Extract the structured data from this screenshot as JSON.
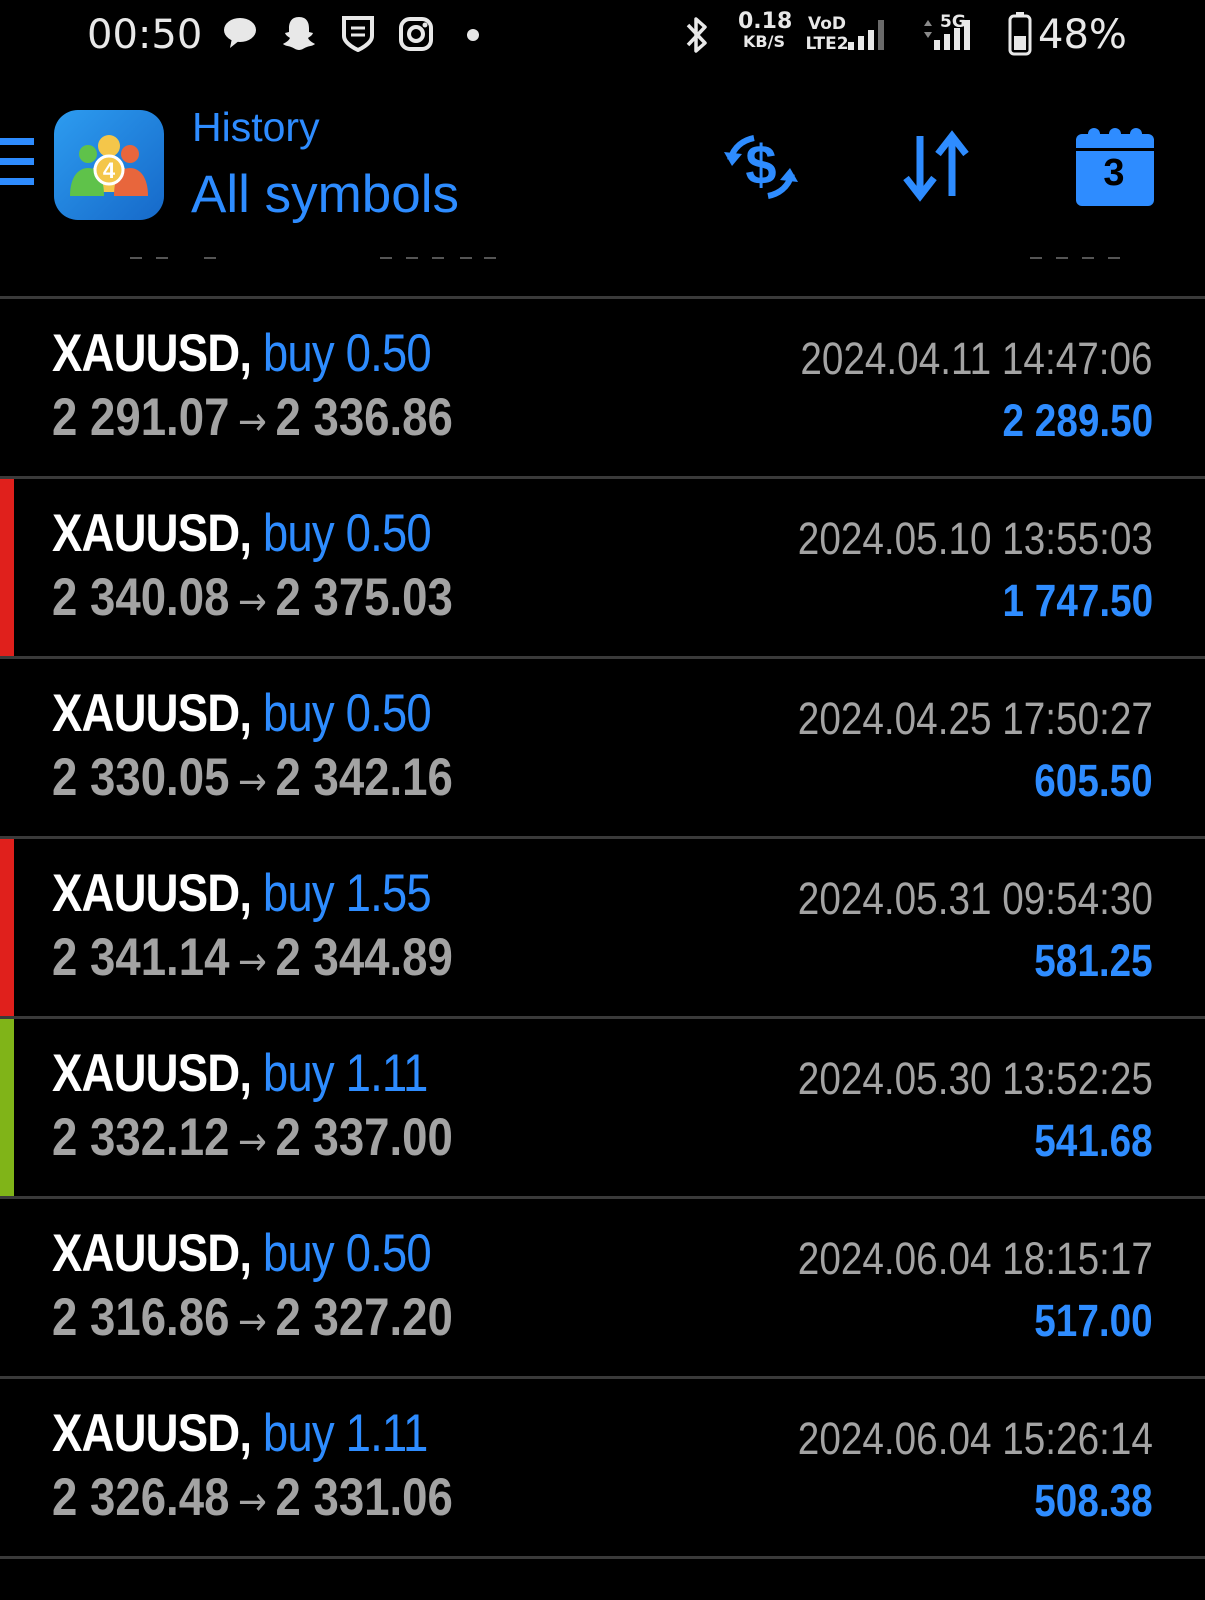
{
  "status_bar": {
    "time": "00:50",
    "net_speed_value": "0.18",
    "net_speed_unit": "KB/S",
    "volte_top": "VoD",
    "volte_bottom": "LTE2",
    "net_type": "5G",
    "battery_percent": "48%",
    "icons": [
      "chat-icon",
      "snapchat-icon",
      "shield-app-icon",
      "instagram-icon",
      "dot-icon",
      "bluetooth-icon",
      "signal-icon",
      "signal-5g-icon",
      "battery-icon"
    ]
  },
  "app_bar": {
    "title": "History",
    "subtitle": "All symbols",
    "logo_badge": "4",
    "calendar_day": "3",
    "accent_color": "#2e8cff",
    "icons": [
      "menu-icon",
      "app-logo-icon",
      "currency-exchange-icon",
      "sort-icon",
      "calendar-icon"
    ]
  },
  "trades": [
    {
      "symbol": "XAUUSD",
      "type": "buy 0.50",
      "open": "2 291.07",
      "close": "2 336.86",
      "time": "2024.04.11 14:47:06",
      "profit": "2 289.50",
      "marker": "none"
    },
    {
      "symbol": "XAUUSD",
      "type": "buy 0.50",
      "open": "2 340.08",
      "close": "2 375.03",
      "time": "2024.05.10 13:55:03",
      "profit": "1 747.50",
      "marker": "red"
    },
    {
      "symbol": "XAUUSD",
      "type": "buy 0.50",
      "open": "2 330.05",
      "close": "2 342.16",
      "time": "2024.04.25 17:50:27",
      "profit": "605.50",
      "marker": "none"
    },
    {
      "symbol": "XAUUSD",
      "type": "buy 1.55",
      "open": "2 341.14",
      "close": "2 344.89",
      "time": "2024.05.31 09:54:30",
      "profit": "581.25",
      "marker": "red"
    },
    {
      "symbol": "XAUUSD",
      "type": "buy 1.11",
      "open": "2 332.12",
      "close": "2 337.00",
      "time": "2024.05.30 13:52:25",
      "profit": "541.68",
      "marker": "green"
    },
    {
      "symbol": "XAUUSD",
      "type": "buy 0.50",
      "open": "2 316.86",
      "close": "2 327.20",
      "time": "2024.06.04 18:15:17",
      "profit": "517.00",
      "marker": "none"
    },
    {
      "symbol": "XAUUSD",
      "type": "buy 1.11",
      "open": "2 326.48",
      "close": "2 331.06",
      "time": "2024.06.04 15:26:14",
      "profit": "508.38",
      "marker": "none"
    }
  ],
  "colors": {
    "background": "#000000",
    "accent": "#2e8cff",
    "marker_red": "#e0201c",
    "marker_green": "#80b418",
    "muted_text": "#a3a3a3"
  }
}
